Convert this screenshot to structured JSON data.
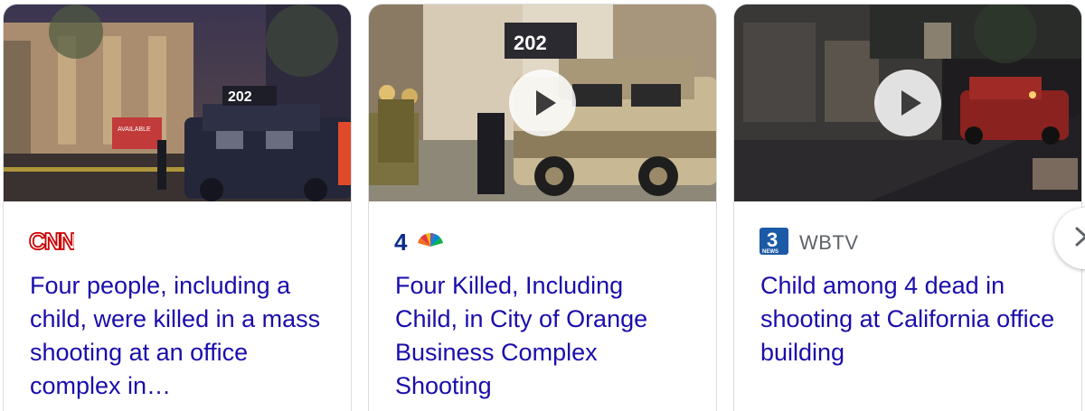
{
  "cards": [
    {
      "source": "CNN",
      "headline": "Four people, including a child, were killed in a mass shooting at an office complex in…",
      "logo_icon": "cnn-logo",
      "has_video": false,
      "thumbnail": {
        "sign_text": "202",
        "banner_text": "AVAILABLE"
      }
    },
    {
      "source": "NBC 4",
      "headline": "Four Killed, Including Child, in City of Orange Business Complex Shooting",
      "logo_icon": "nbc4-logo",
      "logo_number": "4",
      "has_video": true,
      "thumbnail": {
        "sign_text": "202"
      }
    },
    {
      "source": "WBTV",
      "headline": "Child among 4 dead in shooting at California office building",
      "logo_icon": "wbtv-3-news-logo",
      "logo_text": "NEWS",
      "has_video": true,
      "thumbnail": {}
    }
  ],
  "navigation": {
    "next_icon": "chevron-right-icon"
  },
  "colors": {
    "headline": "#1a0dab",
    "source_text": "#5f6368",
    "cnn_red": "#cc0000",
    "nbc_blue": "#0a2d8a",
    "wbtv_blue": "#1c5aa6",
    "card_border": "#dadce0"
  }
}
